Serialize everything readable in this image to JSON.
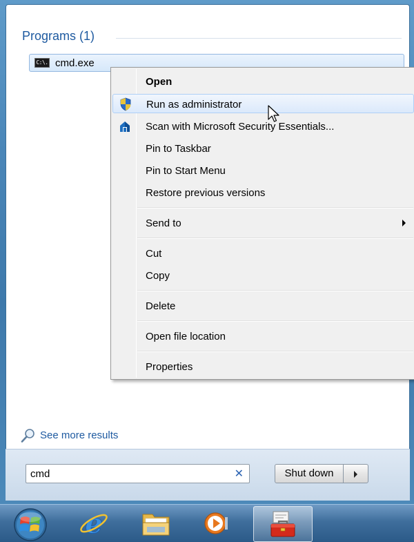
{
  "search_results": {
    "group_header": "Programs (1)",
    "item": {
      "label": "cmd.exe",
      "icon": "cmd-icon",
      "icon_text": "C:\\."
    }
  },
  "context_menu": {
    "items": [
      {
        "label": "Open",
        "bold": true
      },
      {
        "label": "Run as administrator",
        "icon": "uac-shield-icon",
        "hovered": true
      },
      {
        "label": "Scan with Microsoft Security Essentials...",
        "icon": "security-essentials-icon"
      },
      {
        "label": "Pin to Taskbar"
      },
      {
        "label": "Pin to Start Menu"
      },
      {
        "label": "Restore previous versions"
      },
      {
        "label": "Send to",
        "submenu": true
      },
      {
        "label": "Cut"
      },
      {
        "label": "Copy"
      },
      {
        "label": "Delete"
      },
      {
        "label": "Open file location"
      },
      {
        "label": "Properties"
      }
    ]
  },
  "see_more": {
    "label": "See more results",
    "icon": "magnifier-icon"
  },
  "search_box": {
    "value": "cmd",
    "clear_icon": "✕"
  },
  "shutdown": {
    "label": "Shut down"
  },
  "taskbar": {
    "items": [
      "start-orb-icon",
      "internet-explorer-icon",
      "windows-explorer-icon",
      "media-player-icon",
      "toolbox-icon"
    ],
    "active_item": "toolbox-icon"
  },
  "colors": {
    "accent_text": "#1e5aa0",
    "hover_fill": "#dbe9fb",
    "menu_bg": "#f0f0f0",
    "taskbar": "#2b5a88"
  }
}
